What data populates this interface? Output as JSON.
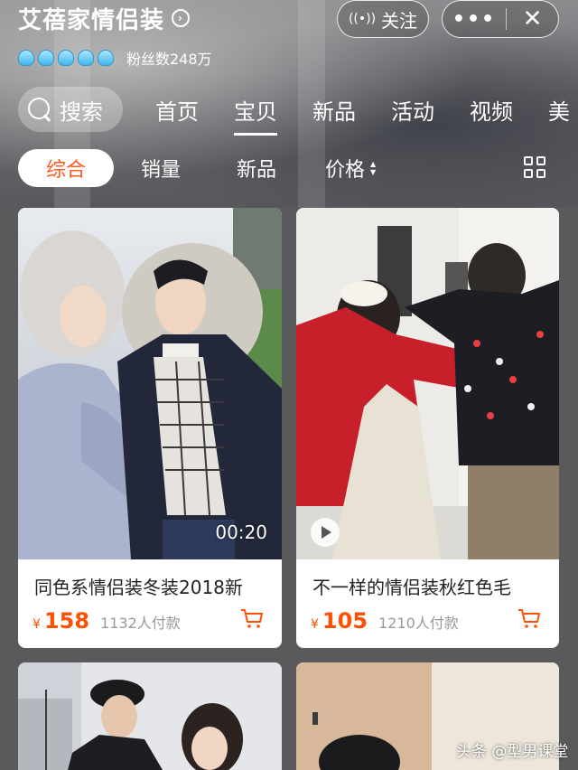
{
  "store": {
    "name": "艾蓓家情侣装",
    "fans_label": "粉丝数248万",
    "rating_icons": [
      "crown-icon",
      "crown-icon",
      "crown-icon",
      "crown-icon",
      "crown-icon"
    ],
    "follow_label": "关注",
    "more_label": "•••",
    "close_label": "✕"
  },
  "nav": {
    "search_label": "搜索",
    "tabs": [
      "首页",
      "宝贝",
      "新品",
      "活动",
      "视频",
      "美"
    ],
    "active_tab": "宝贝"
  },
  "sort": {
    "items": [
      "综合",
      "销量",
      "新品",
      "价格"
    ],
    "active": "综合"
  },
  "products": [
    {
      "title": "同色系情侣装冬装2018新",
      "currency": "¥",
      "price": "158",
      "sold": "1132人付款",
      "video_duration": "00:20"
    },
    {
      "title": "不一样的情侣装秋红色毛",
      "currency": "¥",
      "price": "105",
      "sold": "1210人付款"
    },
    {},
    {}
  ],
  "watermark": "头条 @型男课堂",
  "colors": {
    "accent": "#ff5000",
    "chip_text": "#ff5a1f"
  }
}
